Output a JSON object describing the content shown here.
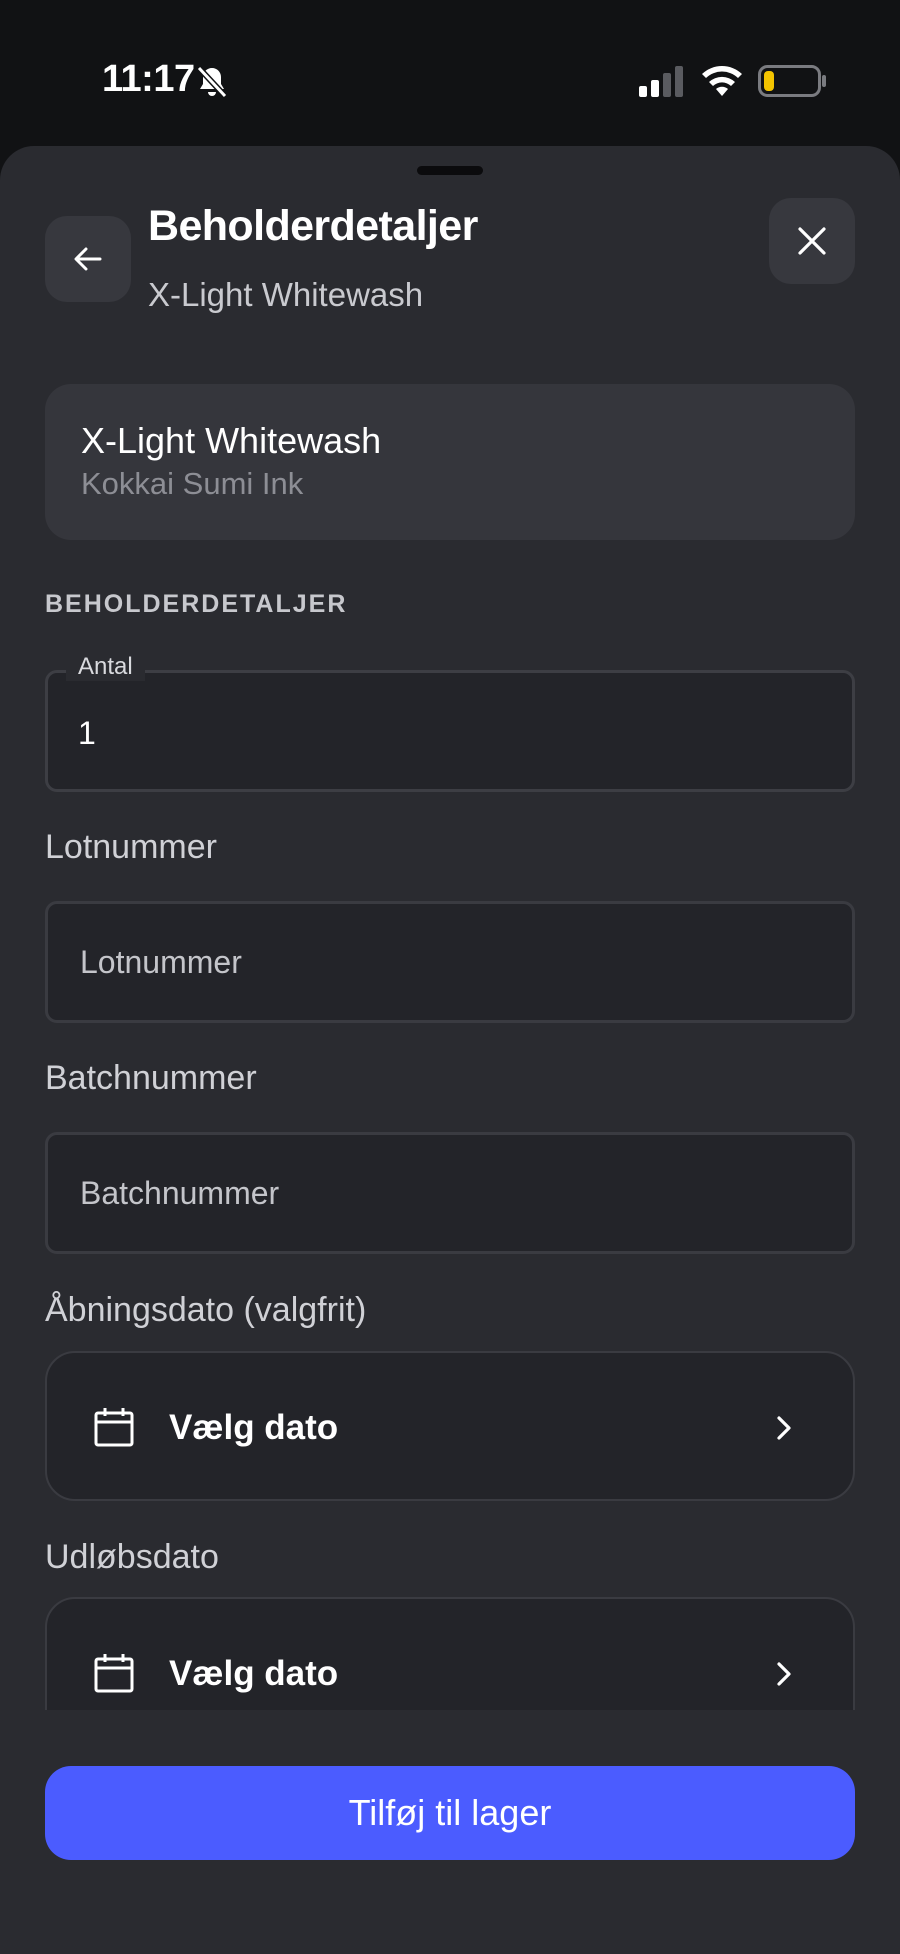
{
  "status_bar": {
    "time": "11:17",
    "icons": [
      "bell-slash-icon",
      "cellular-signal-icon",
      "wifi-icon",
      "battery-low-icon"
    ],
    "battery_color": "#f4c400"
  },
  "header": {
    "back_icon": "arrow-left-icon",
    "title": "Beholderdetaljer",
    "subtitle": "X-Light Whitewash",
    "close_icon": "close-icon"
  },
  "product": {
    "name": "X-Light Whitewash",
    "brand": "Kokkai Sumi Ink"
  },
  "section": {
    "title": "BEHOLDERDETALJER"
  },
  "fields": {
    "quantity": {
      "label": "Antal",
      "value": "1"
    },
    "lot": {
      "label": "Lotnummer",
      "placeholder": "Lotnummer",
      "value": ""
    },
    "batch": {
      "label": "Batchnummer",
      "placeholder": "Batchnummer",
      "value": ""
    },
    "opening_date": {
      "label": "Åbningsdato (valgfrit)",
      "button": "Vælg dato",
      "icon": "calendar-icon"
    },
    "expiry_date": {
      "label": "Udløbsdato",
      "button": "Vælg dato",
      "icon": "calendar-icon"
    }
  },
  "actions": {
    "submit_label": "Tilføj til lager"
  },
  "colors": {
    "background": "#2a2b30",
    "card": "#35363c",
    "input": "#232429",
    "accent": "#4b5cff"
  }
}
